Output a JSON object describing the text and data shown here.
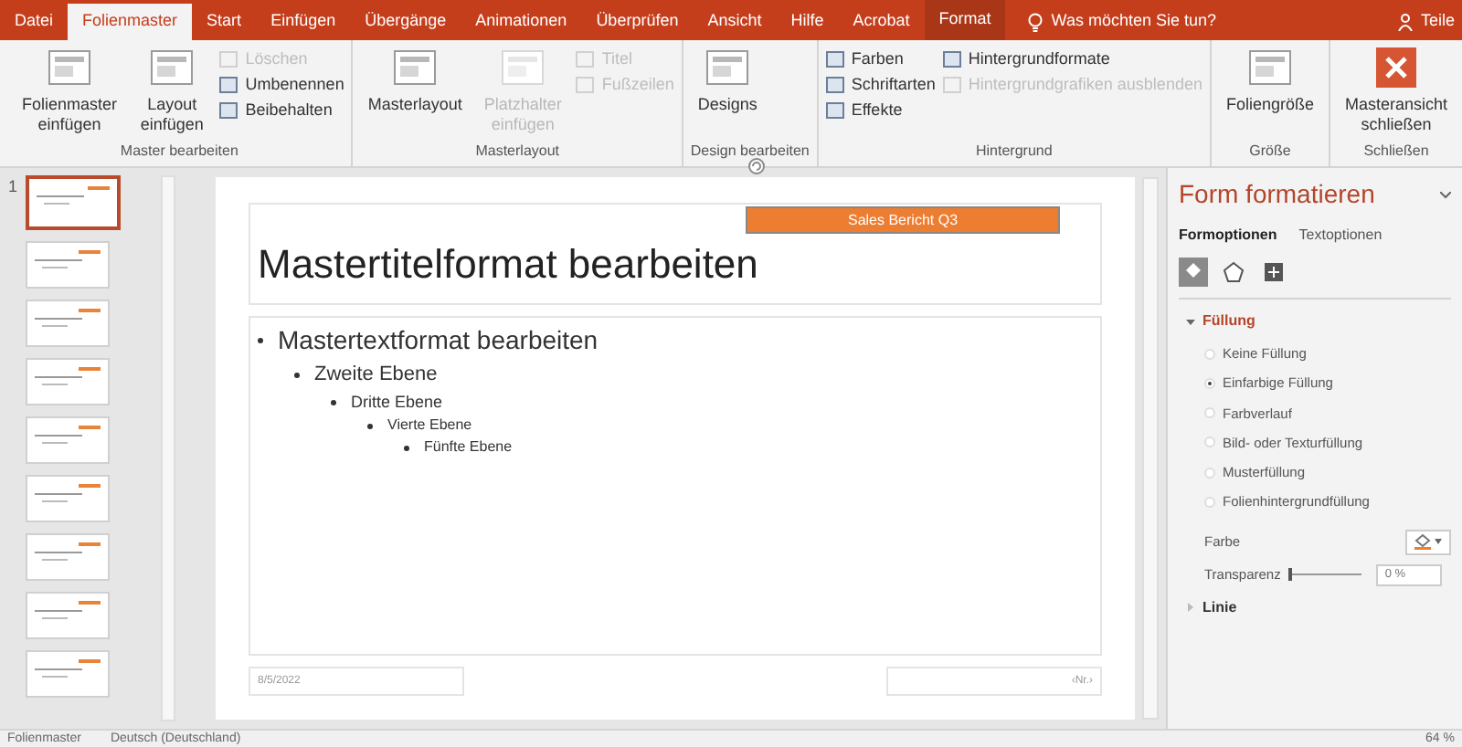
{
  "ribbon_tabs": [
    {
      "label": "Datei",
      "selected": false
    },
    {
      "label": "Folienmaster",
      "selected": true
    },
    {
      "label": "Start",
      "selected": false
    },
    {
      "label": "Einfügen",
      "selected": false
    },
    {
      "label": "Übergänge",
      "selected": false
    },
    {
      "label": "Animationen",
      "selected": false
    },
    {
      "label": "Überprüfen",
      "selected": false
    },
    {
      "label": "Ansicht",
      "selected": false
    },
    {
      "label": "Hilfe",
      "selected": false
    },
    {
      "label": "Acrobat",
      "selected": false
    },
    {
      "label": "Format",
      "selected": false,
      "kind": "contextual"
    }
  ],
  "tell_me": "Was möchten Sie tun?",
  "share": "Teile",
  "ribbon_groups": [
    {
      "label": "Master bearbeiten",
      "items": [
        {
          "kind": "large",
          "label": "Folienmaster einfügen",
          "disabled": false
        },
        {
          "kind": "large",
          "label": "Layout einfügen",
          "disabled": false
        },
        {
          "kind": "stack",
          "items": [
            {
              "label": "Löschen",
              "disabled": true
            },
            {
              "label": "Umbenennen",
              "disabled": false
            },
            {
              "label": "Beibehalten",
              "disabled": false
            }
          ]
        }
      ]
    },
    {
      "label": "Masterlayout",
      "items": [
        {
          "kind": "large",
          "label": "Masterlayout",
          "disabled": false
        },
        {
          "kind": "large",
          "label": "Platzhalter einfügen",
          "disabled": true
        },
        {
          "kind": "stack",
          "items": [
            {
              "label": "Titel",
              "disabled": true
            },
            {
              "label": "Fußzeilen",
              "disabled": true
            }
          ]
        }
      ]
    },
    {
      "label": "Design bearbeiten",
      "items": [
        {
          "kind": "large",
          "label": "Designs",
          "disabled": false
        }
      ]
    },
    {
      "label": "Hintergrund",
      "items": [
        {
          "kind": "stack",
          "items": [
            {
              "label": "Farben",
              "disabled": false
            },
            {
              "label": "Schriftarten",
              "disabled": false
            },
            {
              "label": "Effekte",
              "disabled": false
            }
          ]
        },
        {
          "kind": "stack",
          "items": [
            {
              "label": "Hintergrundformate",
              "disabled": false
            },
            {
              "label": "Hintergrundgrafiken ausblenden",
              "disabled": true
            }
          ]
        }
      ]
    },
    {
      "label": "Größe",
      "items": [
        {
          "kind": "large",
          "label": "Foliengröße",
          "disabled": false
        }
      ]
    },
    {
      "label": "Schließen",
      "items": [
        {
          "kind": "large",
          "label": "Masteransicht schließen",
          "disabled": false
        }
      ]
    }
  ],
  "thumbnails": {
    "number": "1",
    "items": [
      {
        "selected": true
      },
      {
        "selected": false
      },
      {
        "selected": false
      },
      {
        "selected": false
      },
      {
        "selected": false
      },
      {
        "selected": false
      },
      {
        "selected": false
      },
      {
        "selected": false
      },
      {
        "selected": false
      }
    ]
  },
  "slide": {
    "tag": "Sales Bericht Q3",
    "title": "Mastertitelformat bearbeiten",
    "bullets": [
      {
        "text": "Mastertextformat bearbeiten",
        "children": [
          {
            "text": "Zweite Ebene",
            "children": [
              {
                "text": "Dritte Ebene",
                "children": [
                  {
                    "text": "Vierte Ebene",
                    "children": [
                      {
                        "text": "Fünfte Ebene"
                      }
                    ]
                  }
                ]
              }
            ]
          }
        ]
      }
    ],
    "date": "8/5/2022",
    "number": "‹Nr.›"
  },
  "format_pane": {
    "title": "Form formatieren",
    "tabs": [
      {
        "label": "Formoptionen",
        "selected": true
      },
      {
        "label": "Textoptionen",
        "selected": false
      }
    ],
    "icon_tabs": [
      {
        "kind": "fill",
        "selected": true
      },
      {
        "kind": "shape",
        "selected": false
      },
      {
        "kind": "size",
        "selected": false
      }
    ],
    "sections": [
      {
        "label": "Füllung",
        "expanded": true
      },
      {
        "label": "Linie",
        "expanded": false
      }
    ],
    "fill_options": [
      {
        "label": "Keine Füllung",
        "selected": false
      },
      {
        "label": "Einfarbige Füllung",
        "selected": true
      },
      {
        "label": "Farbverlauf",
        "selected": false
      },
      {
        "label": "Bild- oder Texturfüllung",
        "selected": false
      },
      {
        "label": "Musterfüllung",
        "selected": false
      },
      {
        "label": "Folienhintergrundfüllung",
        "selected": false
      }
    ],
    "color_label": "Farbe",
    "transparency": {
      "label": "Transparenz",
      "level": 0,
      "value": "0 %"
    }
  },
  "status_bar": {
    "view": "Folienmaster",
    "language": "Deutsch (Deutschland)",
    "zoom": "64 %"
  }
}
